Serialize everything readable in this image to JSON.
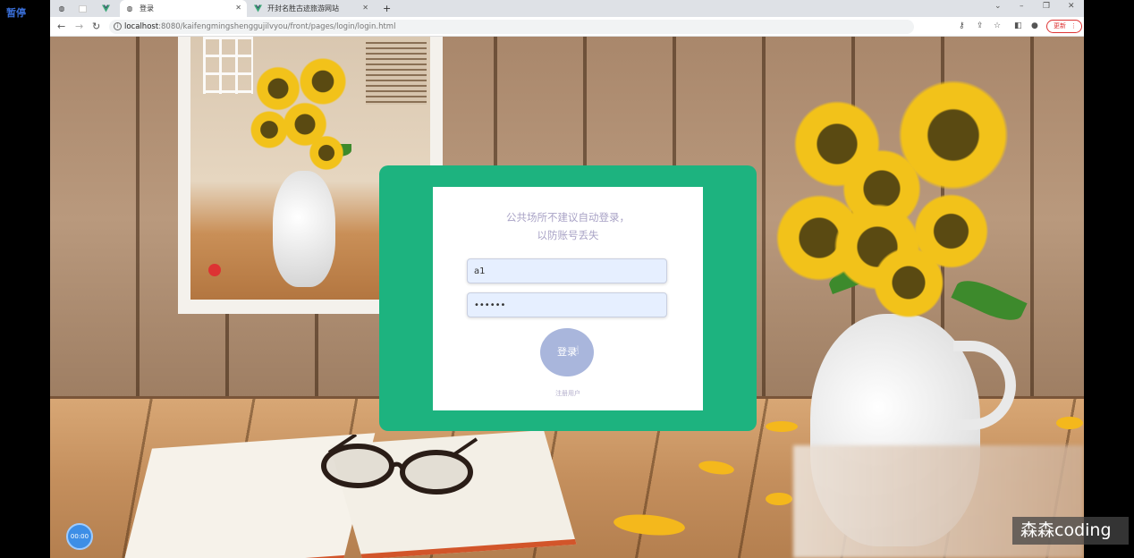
{
  "overlay": {
    "pause_label": "暂停",
    "timer": "00:00",
    "watermark": "森森coding"
  },
  "browser": {
    "tabs": [
      {
        "label": ""
      },
      {
        "label": ""
      },
      {
        "label": "登录"
      },
      {
        "label": "开封名胜古迹旅游网站"
      }
    ],
    "new_tab": "+",
    "url_host": "localhost",
    "url_rest": ":8080/kaifengmingshenggujilvyou/front/pages/login/login.html",
    "update_label": "更新",
    "colors": {
      "update_red": "#d33333"
    }
  },
  "login": {
    "tip": "公共场所不建议自动登录，以防账号丢失",
    "username_value": "a1",
    "password_value": "••••••",
    "login_button": "登录",
    "register_link": "注册用户",
    "colors": {
      "panel_green": "#1db37f",
      "button": "#a9b6dc",
      "tip_text": "#a9a3c6"
    }
  }
}
